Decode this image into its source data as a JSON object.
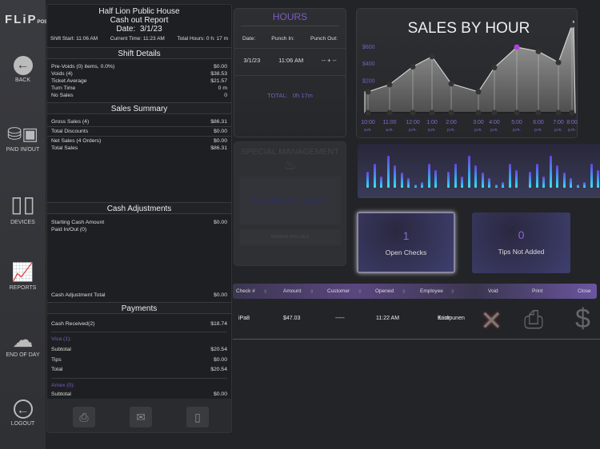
{
  "sidebar": {
    "logo": "FLiP",
    "logo_sub": "POS",
    "items": [
      {
        "label": "BACK",
        "icon": "back-arrow-icon"
      },
      {
        "label": "PAID IN/OUT",
        "icon": "coins-cash-icon"
      },
      {
        "label": "DEVICES",
        "icon": "devices-icon"
      },
      {
        "label": "REPORTS",
        "icon": "presentation-chart-icon"
      },
      {
        "label": "END OF DAY",
        "icon": "moon-cloud-icon"
      },
      {
        "label": "LOGOUT",
        "icon": "logout-icon"
      }
    ]
  },
  "report": {
    "venue": "Half Lion Public House",
    "title": "Cash out Report",
    "date_label": "Date:",
    "date": "3/1/23",
    "shift_start": "Shift Start:   11:06 AM",
    "current_time": "Current Time:   11:23 AM",
    "total_hours": "Total Hours:   0 h: 17 m",
    "shift_details": {
      "title": "Shift Details",
      "rows": [
        [
          "Pre-Voids (0) items, 0.0%)",
          "$0.00"
        ],
        [
          "Voids (4)",
          "$38.53"
        ],
        [
          "Ticket Average",
          "$21.57"
        ],
        [
          "Turn Time",
          "0 m"
        ],
        [
          "No Sales",
          "0"
        ]
      ]
    },
    "sales_summary": {
      "title": "Sales Summary",
      "rows": [
        [
          "Gross Sales (4)",
          "$86.31"
        ],
        [
          "Total Discounts",
          "$0.00"
        ],
        [
          "Net Sales (4 Orders)",
          "$0.00"
        ],
        [
          "Total Sales",
          "$86.31"
        ]
      ]
    },
    "cash_adjustments": {
      "title": "Cash Adjustments",
      "rows": [
        [
          "Starting Cash Amount",
          "$0.00"
        ],
        [
          "Paid In/Out (0)",
          ""
        ]
      ],
      "total": [
        "Cash Adjustment Total",
        "$0.00"
      ]
    },
    "payments": {
      "title": "Payments",
      "cash": [
        "Cash Received(2)",
        "$18.74"
      ],
      "visa_label": "Visa (1):",
      "visa_rows": [
        [
          "Subtotal",
          "$20.54"
        ],
        [
          "Tips",
          "$0.00"
        ],
        [
          "Total",
          "$20.54"
        ]
      ],
      "amex_label": "Amex (0):",
      "amex_rows": [
        [
          "Subtotal",
          "$0.00"
        ]
      ]
    }
  },
  "hours": {
    "title": "HOURS",
    "headers": [
      "Date:",
      "Punch In:",
      "Punch Out:"
    ],
    "row": [
      "3/1/23",
      "11:06 AM",
      "-- + --"
    ],
    "total_label": "TOTAL:",
    "total": "0h 17m"
  },
  "special": {
    "title": "SPECIAL MANAGEMENT",
    "message": "Specials coming soon",
    "button": "MANAGE SPECIALS"
  },
  "kpis": [
    {
      "value": "1",
      "label": "Open Checks"
    },
    {
      "value": "0",
      "label": "Tips Not Added"
    }
  ],
  "table": {
    "headers": [
      "Check #",
      "Amount",
      "Customer",
      "Opened",
      "Employee",
      "Void",
      "Print",
      "Close"
    ],
    "rows": [
      {
        "check": "iPa8",
        "amount": "$47.03",
        "customer": "-----",
        "opened": "11:22 AM",
        "employee_first": "Erich",
        "employee_last": "Kumpunen"
      }
    ]
  },
  "colors": {
    "accent": "#7a5cc0",
    "highlight": "#b040e0"
  },
  "chart_data": {
    "type": "area",
    "title": "SALES BY HOUR",
    "categories": [
      "10:00 a.m.",
      "11:00 a.m.",
      "12:00 p.m.",
      "1:00 p.m.",
      "2:00 p.m.",
      "3:00 p.m.",
      "4:00 p.m.",
      "5:00 p.m.",
      "6:00 p.m.",
      "7:00 p.m.",
      "8:00 p.m."
    ],
    "x_top": [
      "10:00",
      "11:00",
      "12:00",
      "1:00",
      "2:00",
      "3:00",
      "4:00",
      "5:00",
      "6:00",
      "7:00",
      "8:00"
    ],
    "x_bottom": [
      "a.m.",
      "a.m.",
      "p.m.",
      "p.m.",
      "p.m.",
      "p.m.",
      "p.m.",
      "p.m.",
      "p.m.",
      "p.m.",
      "p.m."
    ],
    "values": [
      65,
      150,
      360,
      480,
      160,
      65,
      350,
      590,
      540,
      410,
      850
    ],
    "highlight_index": 7,
    "yticks": [
      200,
      400,
      600
    ],
    "ytick_labels": [
      "$200",
      "$400",
      "$600"
    ],
    "ylim": [
      -180,
      900
    ]
  },
  "mini_bars": [
    0.5,
    0.75,
    0.35,
    1.0,
    0.7,
    0.47,
    0.3,
    0.1,
    0.18,
    0.76,
    0.55
  ]
}
